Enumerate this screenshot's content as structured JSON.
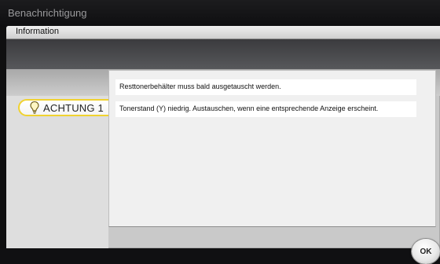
{
  "window": {
    "title": "Benachrichtigung"
  },
  "tab": {
    "label": "Information"
  },
  "alert": {
    "label": "ACHTUNG 1",
    "icon": "lightbulb-icon",
    "accent": "#f0d230"
  },
  "messages": [
    "Resttonerbehälter muss bald ausgetauscht werden.",
    "Tonerstand (Y) niedrig. Austauschen, wenn eine entsprechende Anzeige erscheint."
  ],
  "ok_button": {
    "label": "OK"
  }
}
